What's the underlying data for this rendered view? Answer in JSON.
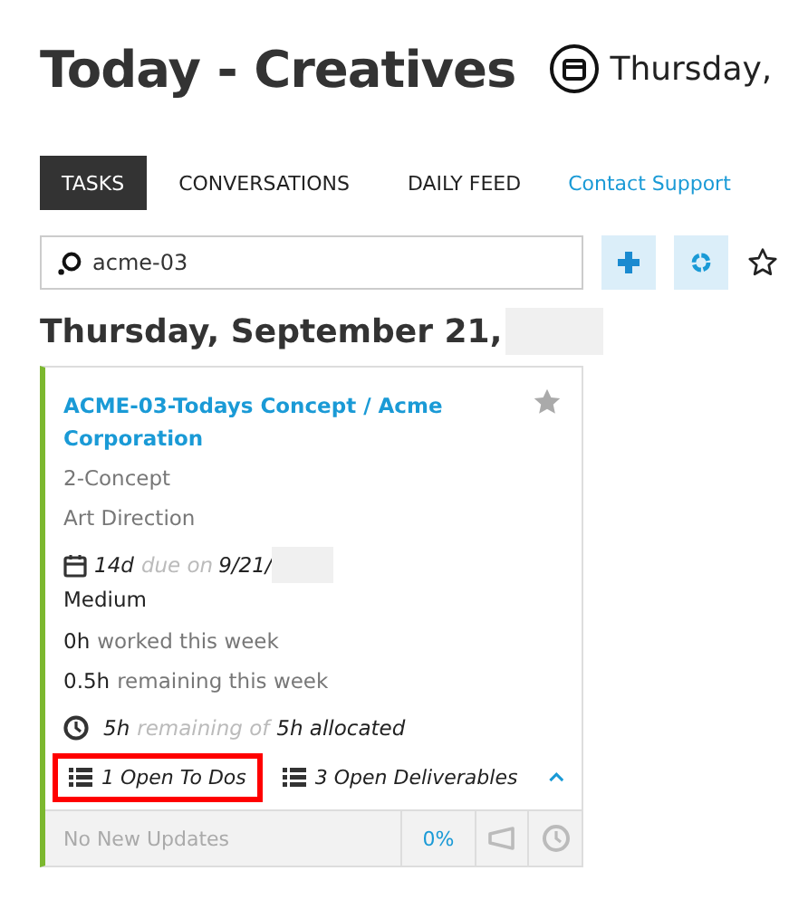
{
  "header": {
    "title": "Today - Creatives",
    "date": "Thursday,"
  },
  "tabs": [
    {
      "label": "TASKS",
      "selected": true
    },
    {
      "label": "CONVERSATIONS",
      "selected": false
    },
    {
      "label": "DAILY FEED",
      "selected": false
    }
  ],
  "support_link": "Contact Support",
  "search": {
    "value": "acme-03"
  },
  "day_heading": "Thursday, September 21,",
  "task": {
    "title": "ACME-03-Todays Concept / Acme Corporation",
    "starred": false,
    "phase": "2-Concept",
    "role": "Art Direction",
    "due_value": "14d",
    "due_label": "due on",
    "due_date": "9/21/",
    "priority": "Medium",
    "worked_value": "0h",
    "worked_label": "worked this week",
    "remaining_value": "0.5h",
    "remaining_label": "remaining this week",
    "alloc_value": "5h",
    "alloc_label": "remaining of",
    "alloc_total": "5h allocated",
    "todos": {
      "text": "1 Open To Dos",
      "highlighted": true
    },
    "deliverables": "3 Open Deliverables",
    "expanded": true,
    "updates": "No New Updates",
    "percent": "0%"
  }
}
